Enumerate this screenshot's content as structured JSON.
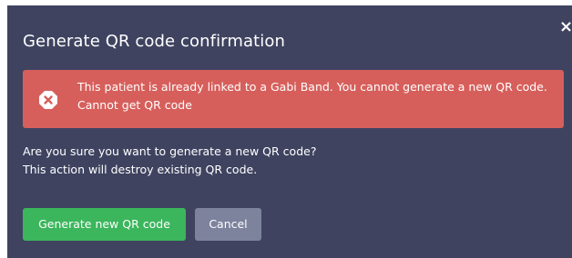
{
  "modal": {
    "close_label": "×",
    "title": "Generate QR code confirmation",
    "alert": {
      "icon": "error-circle-x-icon",
      "line1": "This patient is already linked to a Gabi Band. You cannot generate a new QR code.",
      "line2": "Cannot get QR code",
      "color": "#d75f5b"
    },
    "message": {
      "line1": "Are you sure you want to generate a new QR code?",
      "line2": "This action will destroy existing QR code."
    },
    "buttons": {
      "confirm_label": "Generate new QR code",
      "cancel_label": "Cancel"
    },
    "colors": {
      "background": "#3f4360",
      "confirm": "#3bb65c",
      "cancel": "#7d829d"
    }
  }
}
